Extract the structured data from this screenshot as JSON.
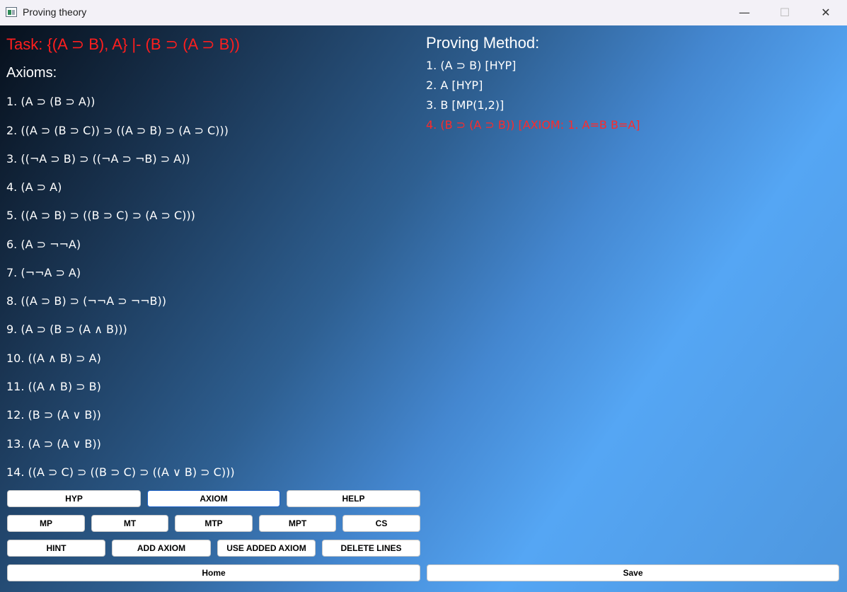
{
  "window": {
    "title": "Proving theory",
    "minimize": "—",
    "maximize": "☐",
    "close": "✕"
  },
  "task": "Task: {(A ⊃ B), A} |- (B ⊃ (A ⊃ B))",
  "axioms": {
    "title": "Axioms:",
    "items": [
      "1. (A ⊃  (B ⊃  A))",
      "2. ((A ⊃  (B ⊃  C)) ⊃  ((A ⊃  B) ⊃  (A ⊃  C)))",
      "3. ((¬A ⊃  B) ⊃  ((¬A ⊃  ¬B) ⊃  A))",
      "4. (A ⊃  A)",
      "5. ((A ⊃  B) ⊃  ((B ⊃  C) ⊃  (A ⊃  C)))",
      "6. (A ⊃  ¬¬A)",
      "7. (¬¬A ⊃  A)",
      "8. ((A ⊃  B) ⊃  (¬¬A ⊃  ¬¬B))",
      "9. (A ⊃  (B ⊃  (A ∧  B)))",
      "10. ((A ∧  B) ⊃  A)",
      "11. ((A ∧  B) ⊃  B)",
      "12. (B ⊃  (A ∨  B))",
      "13. (A ⊃  (A ∨  B))",
      "14. ((A ⊃  C) ⊃  ((B ⊃  C) ⊃  ((A ∨  B) ⊃  C)))"
    ]
  },
  "method": {
    "title": "Proving Method:",
    "lines": [
      "1. (A ⊃  B) [HYP]",
      "2. A [HYP]",
      "3. B [MP(1,2)]",
      "4. (B ⊃  (A ⊃  B)) [AXIOM: 1. A=B B=A]"
    ]
  },
  "buttons": {
    "hyp": "HYP",
    "axiom": "AXIOM",
    "help": "HELP",
    "mp": "MP",
    "mt": "MT",
    "mtp": "MTP",
    "mpt": "MPT",
    "cs": "CS",
    "hint": "HINT",
    "add_axiom": "ADD AXIOM",
    "use_added_axiom": "USE ADDED AXIOM",
    "delete_lines": "DELETE LINES",
    "home": "Home",
    "save": "Save"
  },
  "colors": {
    "task_text": "#ff1e1e",
    "current_line": "#ff2a2a",
    "focused_border": "#1e62c8"
  }
}
